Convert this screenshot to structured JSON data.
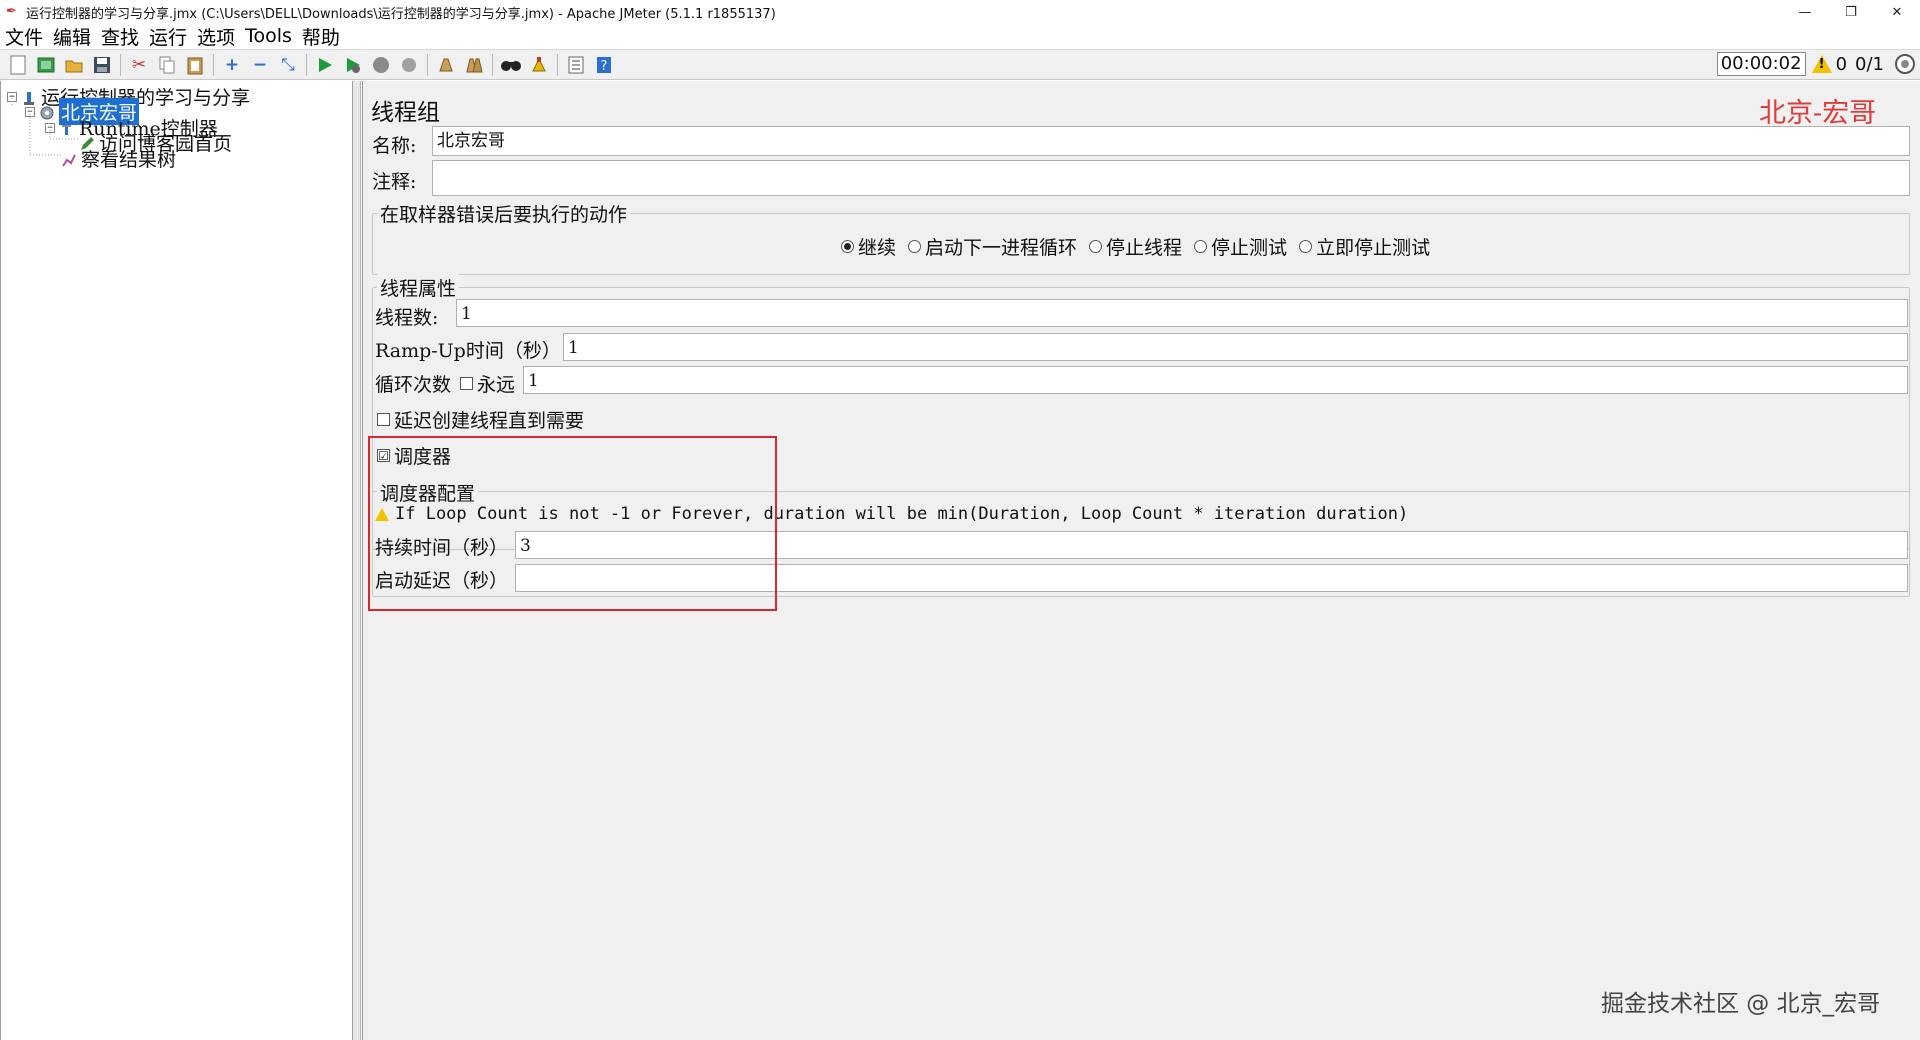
{
  "window": {
    "title": "运行控制器的学习与分享.jmx (C:\\Users\\DELL\\Downloads\\运行控制器的学习与分享.jmx) - Apache JMeter (5.1.1 r1855137)",
    "minimize": "—",
    "restore": "❐",
    "close": "✕"
  },
  "menu": [
    "文件",
    "编辑",
    "查找",
    "运行",
    "选项",
    "Tools",
    "帮助"
  ],
  "toolbar": {
    "timer": "00:00:02",
    "warn_count": "0",
    "thread_count": "0/1"
  },
  "tree": {
    "root": "运行控制器的学习与分享",
    "thread_group": "北京宏哥",
    "runtime_controller": "Runtime控制器",
    "sampler": "访问博客园首页",
    "listener": "察看结果树"
  },
  "panel": {
    "header": "线程组",
    "brand": "北京-宏哥",
    "name_label": "名称:",
    "name_value": "北京宏哥",
    "comment_label": "注释:",
    "comment_value": "",
    "error_action_title": "在取样器错误后要执行的动作",
    "error_actions": [
      {
        "label": "继续",
        "selected": true
      },
      {
        "label": "启动下一进程循环",
        "selected": false
      },
      {
        "label": "停止线程",
        "selected": false
      },
      {
        "label": "停止测试",
        "selected": false
      },
      {
        "label": "立即停止测试",
        "selected": false
      }
    ],
    "thread_props_title": "线程属性",
    "threads_label": "线程数:",
    "threads_value": "1",
    "rampup_label": "Ramp-Up时间（秒）:",
    "rampup_value": "1",
    "loop_label": "循环次数",
    "forever_label": "永远",
    "loop_value": "1",
    "delay_label": "延迟创建线程直到需要",
    "scheduler_label": "调度器",
    "scheduler_checked": "☑",
    "scheduler_config_title": "调度器配置",
    "scheduler_warning": "If Loop Count is not -1 or Forever, duration will be min(Duration, Loop Count * iteration duration)",
    "duration_label": "持续时间（秒）",
    "duration_value": "3",
    "startup_delay_label": "启动延迟（秒）",
    "startup_delay_value": ""
  },
  "watermark": "掘金技术社区 @ 北京_宏哥"
}
